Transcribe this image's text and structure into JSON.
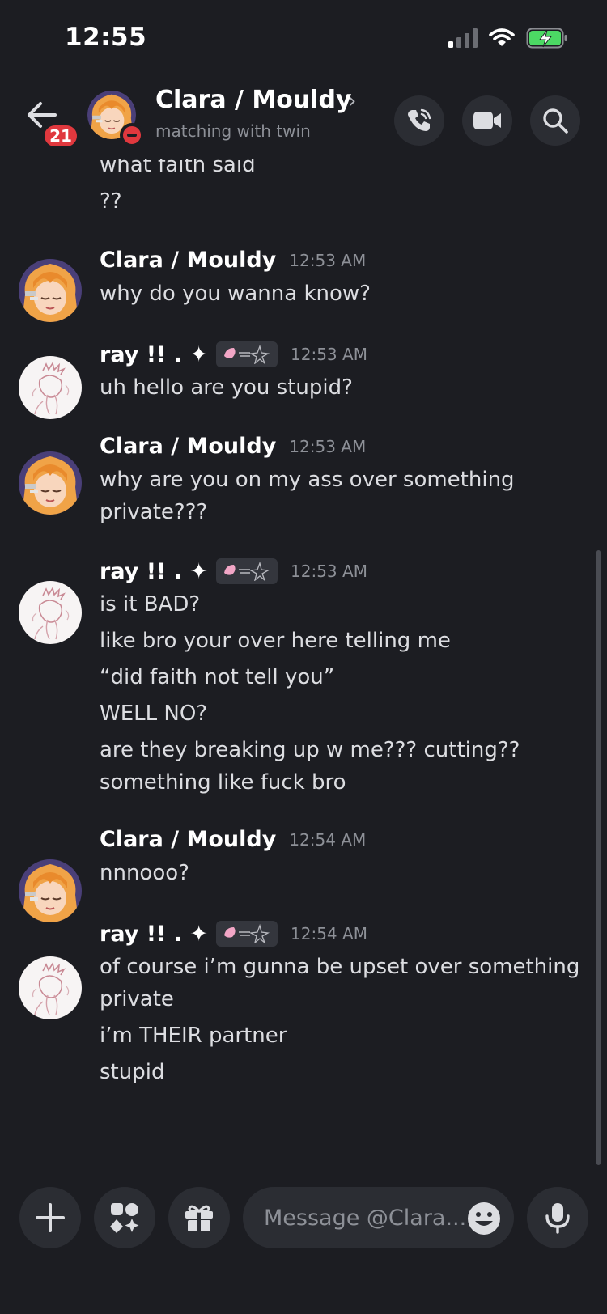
{
  "status_bar": {
    "time": "12:55"
  },
  "header": {
    "back_badge": "21",
    "title": "Clara / Mouldy",
    "chevron": "›",
    "subtitle": "matching with twin"
  },
  "messages": {
    "continuation_lines": [
      "what faith said",
      "??"
    ],
    "groups": [
      {
        "author": "Clara / Mouldy",
        "time": "12:53 AM",
        "lines": [
          "why do you wanna know?"
        ]
      },
      {
        "author": "ray !! . ✦",
        "time": "12:53 AM",
        "lines": [
          "uh hello are you stupid?"
        ]
      },
      {
        "author": "Clara / Mouldy",
        "time": "12:53 AM",
        "lines": [
          "why are you on my ass over something",
          "private???"
        ]
      },
      {
        "author": "ray !! . ✦",
        "time": "12:53 AM",
        "lines": [
          "is it BAD?",
          "like bro your over here telling me",
          "“did faith not tell you”",
          "WELL NO?",
          "are they breaking up w me??? cutting??",
          "something like fuck bro"
        ]
      },
      {
        "author": "Clara / Mouldy",
        "time": "12:54 AM",
        "lines": [
          "nnnooo?"
        ]
      },
      {
        "author": "ray !! . ✦",
        "time": "12:54 AM",
        "lines": [
          "of course i’m gunna be upset over something",
          "private",
          "i’m THEIR partner",
          "stupid"
        ]
      }
    ]
  },
  "composer": {
    "placeholder": "Message @Clara..."
  },
  "colors": {
    "background": "#1c1d22",
    "surface": "#2b2d33",
    "badge_red": "#e0383e",
    "battery_green": "#4cd964"
  },
  "icons": [
    "back-arrow-icon",
    "phone-call-icon",
    "video-camera-icon",
    "search-icon",
    "plus-icon",
    "apps-icon",
    "gift-icon",
    "emoji-icon",
    "microphone-icon",
    "signal-icon",
    "wifi-icon",
    "battery-charging-icon"
  ]
}
